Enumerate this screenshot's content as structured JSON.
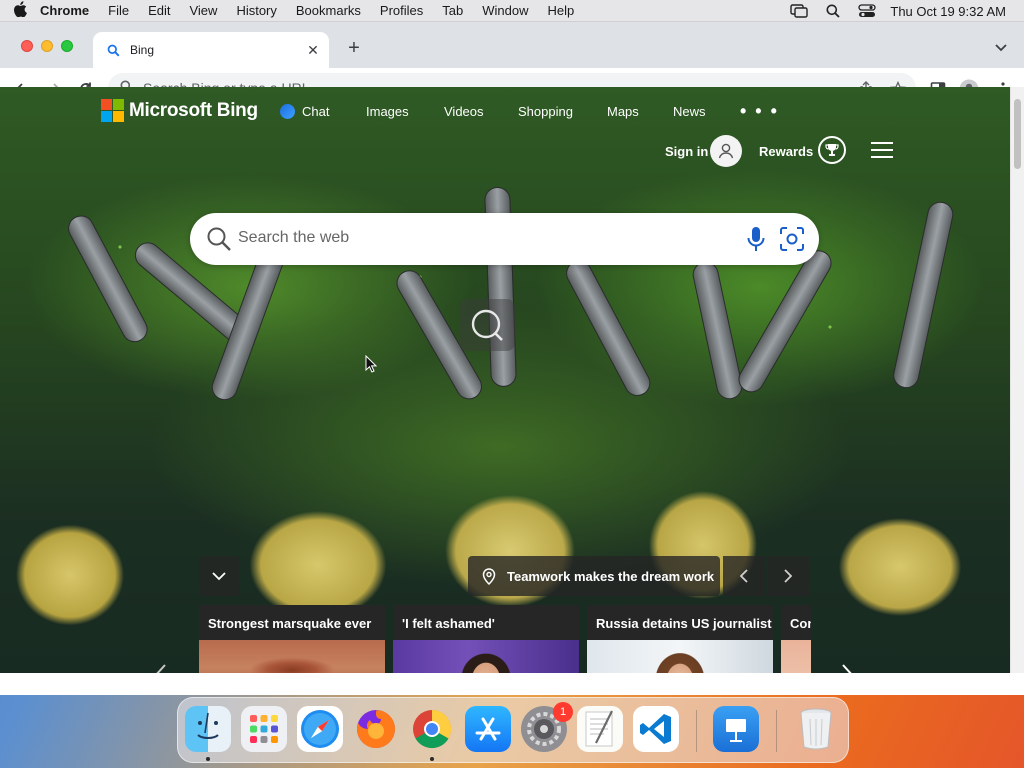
{
  "menubar": {
    "app_name": "Chrome",
    "items": [
      "File",
      "Edit",
      "View",
      "History",
      "Bookmarks",
      "Profiles",
      "Tab",
      "Window",
      "Help"
    ],
    "clock": "Thu Oct 19  9:32 AM"
  },
  "browser": {
    "tab_title": "Bing",
    "omnibox_placeholder": "Search Bing or type a URL"
  },
  "bing": {
    "logo_text": "Microsoft Bing",
    "nav": [
      "Chat",
      "Images",
      "Videos",
      "Shopping",
      "Maps",
      "News"
    ],
    "more": "• • •",
    "sign_in": "Sign in",
    "rewards": "Rewards",
    "search_placeholder": "Search the web",
    "caption": "Teamwork makes the dream work",
    "news": [
      {
        "title": "Strongest marsquake ever"
      },
      {
        "title": "'I felt ashamed'"
      },
      {
        "title": "Russia detains US journalist"
      },
      {
        "title": "Con"
      }
    ]
  },
  "dock": {
    "apps": [
      "Finder",
      "Launchpad",
      "Safari",
      "Firefox",
      "Google Chrome",
      "App Store",
      "System Settings",
      "TextEdit",
      "Visual Studio Code",
      "Keynote",
      "Trash"
    ],
    "settings_badge": "1"
  },
  "colors": {
    "ms_red": "#f25022",
    "ms_green": "#7fba00",
    "ms_blue": "#00a4ef",
    "ms_yellow": "#ffb900"
  }
}
